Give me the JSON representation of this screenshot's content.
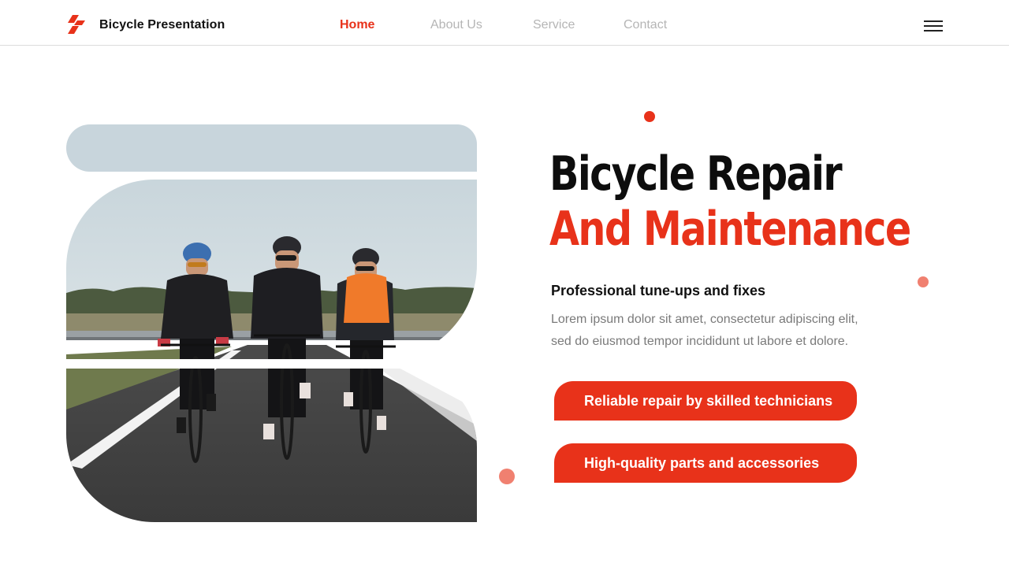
{
  "header": {
    "brand": "Bicycle Presentation",
    "nav": [
      "Home",
      "About Us",
      "Service",
      "Contact"
    ],
    "active_nav": "Home"
  },
  "hero": {
    "title_line1": "Bicycle Repair",
    "title_line2": "And Maintenance",
    "subtitle": "Professional tune-ups and fixes",
    "description_line1": "Lorem ipsum dolor sit amet, consectetur  adipiscing elit,",
    "description_line2": "sed do eiusmod tempor incididunt ut labore et dolore.",
    "features": [
      "Reliable repair by skilled technicians",
      "High-quality parts and accessories"
    ]
  },
  "colors": {
    "accent": "#e8321a",
    "accent_light": "#f08070",
    "text_dark": "#111111",
    "text_muted": "#7a7a7a",
    "nav_inactive": "#b5b5b5"
  },
  "icons": {
    "logo": "bicycle-logo-icon",
    "menu": "hamburger-menu-icon"
  },
  "image": {
    "subject": "three cyclists riding on a road"
  }
}
